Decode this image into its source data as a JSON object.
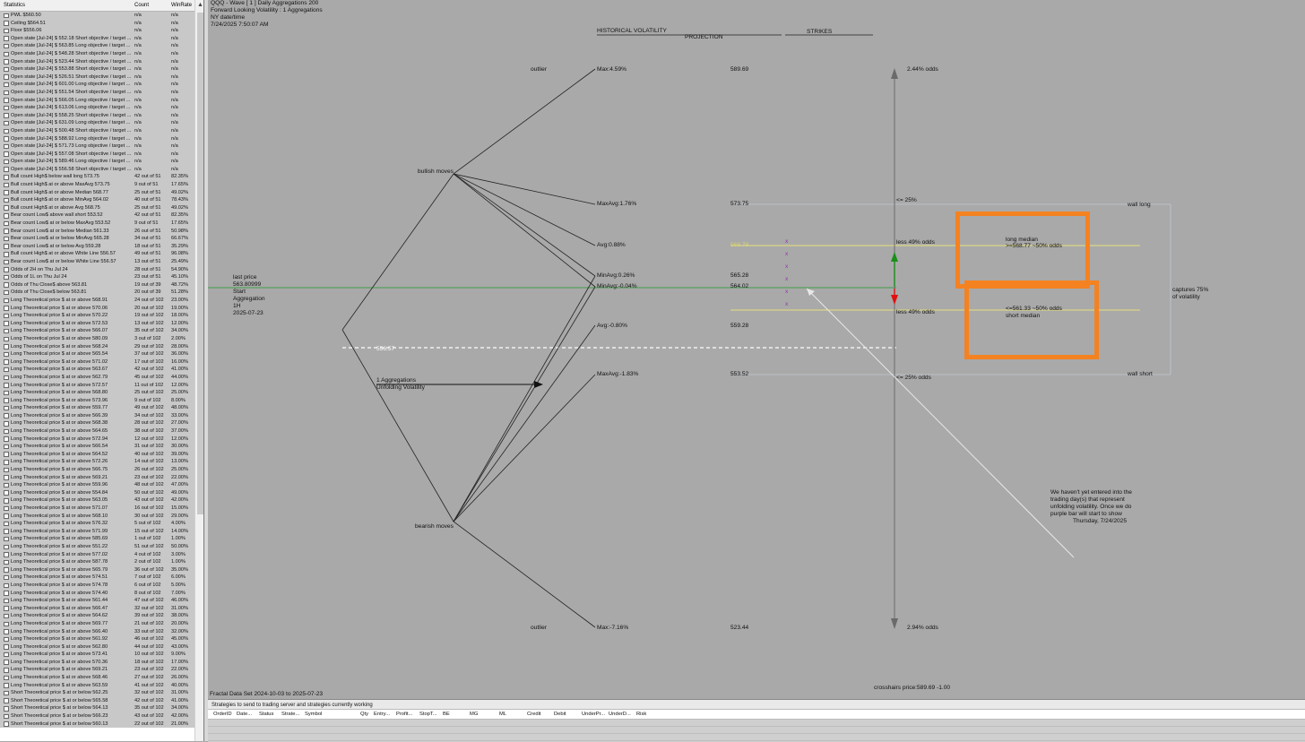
{
  "stats_panel": {
    "headers": {
      "name": "Statistics",
      "count": "Count",
      "winrate": "WinRate"
    },
    "rows": [
      [
        "PWL $560.50",
        "n/a",
        "n/a"
      ],
      [
        "Ceiling $564.51",
        "n/a",
        "n/a"
      ],
      [
        "Floor $556.06",
        "n/a",
        "n/a"
      ],
      [
        "Open state [Jul-24] $ 552.18 Short objective / target ...",
        "n/a",
        "n/a"
      ],
      [
        "Open state [Jul-24] $ 563.85 Long objective / target ...",
        "n/a",
        "n/a"
      ],
      [
        "Open state [Jul-24] $ 548.28 Short objective / target ...",
        "n/a",
        "n/a"
      ],
      [
        "Open state [Jul-24] $ 523.44 Short objective / target ...",
        "n/a",
        "n/a"
      ],
      [
        "Open state [Jul-24] $ 553.88 Short objective / target ...",
        "n/a",
        "n/a"
      ],
      [
        "Open state [Jul-24] $ 526.51 Short objective / target ...",
        "n/a",
        "n/a"
      ],
      [
        "Open state [Jul-24] $ 601.00 Long objective / target ...",
        "n/a",
        "n/a"
      ],
      [
        "Open state [Jul-24] $ 551.54 Short objective / target ...",
        "n/a",
        "n/a"
      ],
      [
        "Open state [Jul-24] $ 566.05 Long objective / target ...",
        "n/a",
        "n/a"
      ],
      [
        "Open state [Jul-24] $ 613.06 Long objective / target ...",
        "n/a",
        "n/a"
      ],
      [
        "Open state [Jul-24] $ 558.25 Short objective / target ...",
        "n/a",
        "n/a"
      ],
      [
        "Open state [Jul-24] $ 631.09 Long objective / target ...",
        "n/a",
        "n/a"
      ],
      [
        "Open state [Jul-24] $ 500.48 Short objective / target ...",
        "n/a",
        "n/a"
      ],
      [
        "Open state [Jul-24] $ 588.92 Long objective / target ...",
        "n/a",
        "n/a"
      ],
      [
        "Open state [Jul-24] $ 571.73 Long objective / target ...",
        "n/a",
        "n/a"
      ],
      [
        "Open state [Jul-24] $ 557.08 Short objective / target ...",
        "n/a",
        "n/a"
      ],
      [
        "Open state [Jul-24] $ 589.46 Long objective / target ...",
        "n/a",
        "n/a"
      ],
      [
        "Open state [Jul-24] $ 556.58 Short objective / target ...",
        "n/a",
        "n/a"
      ],
      [
        "Bull count High$ below wall long 573.75",
        "42 out of 51",
        "82.35%"
      ],
      [
        "Bull count High$ at or above MaxAvg 573.75",
        "9 out of 51",
        "17.65%"
      ],
      [
        "Bull count High$ at or above Median 568.77",
        "25 out of 51",
        "49.02%"
      ],
      [
        "Bull count High$ at or above MinAvg 564.02",
        "40 out of 51",
        "78.43%"
      ],
      [
        "Bull count High$ at or above Avg 568.75",
        "25 out of 51",
        "49.02%"
      ],
      [
        "Bear count Low$ above wall short 553.52",
        "42 out of 51",
        "82.35%"
      ],
      [
        "Bear count Low$ at or below MaxAvg 553.52",
        "9 out of 51",
        "17.65%"
      ],
      [
        "Bear count Low$ at or below Median 561.33",
        "26 out of 51",
        "50.98%"
      ],
      [
        "Bear count Low$ at or below MinAvg 565.28",
        "34 out of 51",
        "66.67%"
      ],
      [
        "Bear count Low$ at or below Avg 559.28",
        "18 out of 51",
        "35.29%"
      ],
      [
        "Bull count High$ at or above White Line 556.57",
        "49 out of 51",
        "96.08%"
      ],
      [
        "Bear count Low$ at or below White Line 556.57",
        "13 out of 51",
        "25.49%"
      ],
      [
        "Odds of 2H on Thu Jul 24",
        "28 out of 51",
        "54.90%"
      ],
      [
        "Odds of 1L on Thu Jul 24",
        "23 out of 51",
        "45.10%"
      ],
      [
        "Odds of Thu Close$ above 563.81",
        "19 out of 39",
        "48.72%"
      ],
      [
        "Odds of Thu Close$ below 563.81",
        "20 out of 39",
        "51.28%"
      ],
      [
        "Long Theoretical price $ at or above 568.91",
        "24 out of 102",
        "23.00%"
      ],
      [
        "Long Theoretical price $ at or above 570.06",
        "20 out of 102",
        "19.00%"
      ],
      [
        "Long Theoretical price $ at or above 570.22",
        "19 out of 102",
        "18.00%"
      ],
      [
        "Long Theoretical price $ at or above 572.53",
        "13 out of 102",
        "12.00%"
      ],
      [
        "Long Theoretical price $ at or above 566.07",
        "35 out of 102",
        "34.00%"
      ],
      [
        "Long Theoretical price $ at or above 580.09",
        "3 out of 102",
        "2.00%"
      ],
      [
        "Long Theoretical price $ at or above 568.24",
        "29 out of 102",
        "28.00%"
      ],
      [
        "Long Theoretical price $ at or above 565.54",
        "37 out of 102",
        "36.00%"
      ],
      [
        "Long Theoretical price $ at or above 571.02",
        "17 out of 102",
        "16.00%"
      ],
      [
        "Long Theoretical price $ at or above 563.67",
        "42 out of 102",
        "41.00%"
      ],
      [
        "Long Theoretical price $ at or above 562.79",
        "45 out of 102",
        "44.00%"
      ],
      [
        "Long Theoretical price $ at or above 572.57",
        "11 out of 102",
        "12.00%"
      ],
      [
        "Long Theoretical price $ at or above 568.80",
        "25 out of 102",
        "25.00%"
      ],
      [
        "Long Theoretical price $ at or above 573.96",
        "9 out of 102",
        "8.00%"
      ],
      [
        "Long Theoretical price $ at or above 559.77",
        "49 out of 102",
        "48.00%"
      ],
      [
        "Long Theoretical price $ at or above 566.39",
        "34 out of 102",
        "33.00%"
      ],
      [
        "Long Theoretical price $ at or above 568.38",
        "28 out of 102",
        "27.00%"
      ],
      [
        "Long Theoretical price $ at or above 564.65",
        "38 out of 102",
        "37.00%"
      ],
      [
        "Long Theoretical price $ at or above 572.94",
        "12 out of 102",
        "12.00%"
      ],
      [
        "Long Theoretical price $ at or above 566.54",
        "31 out of 102",
        "30.00%"
      ],
      [
        "Long Theoretical price $ at or above 564.52",
        "40 out of 102",
        "39.00%"
      ],
      [
        "Long Theoretical price $ at or above 572.26",
        "14 out of 102",
        "13.00%"
      ],
      [
        "Long Theoretical price $ at or above 566.75",
        "26 out of 102",
        "25.00%"
      ],
      [
        "Long Theoretical price $ at or above 569.21",
        "23 out of 102",
        "22.00%"
      ],
      [
        "Long Theoretical price $ at or above 559.96",
        "48 out of 102",
        "47.00%"
      ],
      [
        "Long Theoretical price $ at or above 554.84",
        "50 out of 102",
        "49.00%"
      ],
      [
        "Long Theoretical price $ at or above 563.05",
        "43 out of 102",
        "42.00%"
      ],
      [
        "Long Theoretical price $ at or above 571.07",
        "16 out of 102",
        "15.00%"
      ],
      [
        "Long Theoretical price $ at or above 568.10",
        "30 out of 102",
        "29.00%"
      ],
      [
        "Long Theoretical price $ at or above 576.32",
        "5 out of 102",
        "4.00%"
      ],
      [
        "Long Theoretical price $ at or above 571.99",
        "15 out of 102",
        "14.00%"
      ],
      [
        "Long Theoretical price $ at or above 585.69",
        "1 out of 102",
        "1.00%"
      ],
      [
        "Long Theoretical price $ at or above 551.22",
        "51 out of 102",
        "50.00%"
      ],
      [
        "Long Theoretical price $ at or above 577.02",
        "4 out of 102",
        "3.00%"
      ],
      [
        "Long Theoretical price $ at or above 587.78",
        "2 out of 102",
        "1.00%"
      ],
      [
        "Long Theoretical price $ at or above 565.79",
        "36 out of 102",
        "35.00%"
      ],
      [
        "Long Theoretical price $ at or above 574.51",
        "7 out of 102",
        "6.00%"
      ],
      [
        "Long Theoretical price $ at or above 574.78",
        "6 out of 102",
        "5.00%"
      ],
      [
        "Long Theoretical price $ at or above 574.40",
        "8 out of 102",
        "7.00%"
      ],
      [
        "Long Theoretical price $ at or above 561.44",
        "47 out of 102",
        "46.00%"
      ],
      [
        "Long Theoretical price $ at or above 566.47",
        "32 out of 102",
        "31.00%"
      ],
      [
        "Long Theoretical price $ at or above 564.62",
        "39 out of 102",
        "38.00%"
      ],
      [
        "Long Theoretical price $ at or above 569.77",
        "21 out of 102",
        "20.00%"
      ],
      [
        "Long Theoretical price $ at or above 566.40",
        "33 out of 102",
        "32.00%"
      ],
      [
        "Long Theoretical price $ at or above 561.92",
        "46 out of 102",
        "45.00%"
      ],
      [
        "Long Theoretical price $ at or above 562.80",
        "44 out of 102",
        "43.00%"
      ],
      [
        "Long Theoretical price $ at or above 573.41",
        "10 out of 102",
        "9.00%"
      ],
      [
        "Long Theoretical price $ at or above 570.36",
        "18 out of 102",
        "17.00%"
      ],
      [
        "Long Theoretical price $ at or above 569.21",
        "23 out of 102",
        "22.00%"
      ],
      [
        "Long Theoretical price $ at or above 568.46",
        "27 out of 102",
        "26.00%"
      ],
      [
        "Long Theoretical price $ at or above 563.59",
        "41 out of 102",
        "40.00%"
      ],
      [
        "Short Theoretical price $ at or below 562.25",
        "32 out of 102",
        "31.00%"
      ],
      [
        "Short Theoretical price $ at or below 565.58",
        "42 out of 102",
        "41.00%"
      ],
      [
        "Short Theoretical price $ at or below 564.13",
        "35 out of 102",
        "34.00%"
      ],
      [
        "Short Theoretical price $ at or below 566.23",
        "43 out of 102",
        "42.00%"
      ],
      [
        "Short Theoretical price $ at or below 560.13",
        "22 out of 102",
        "21.00%"
      ]
    ]
  },
  "chart_header": {
    "line1": "QQQ - Wave [ 1 ] Daily  Aggregations 200",
    "line2": "Forward Looking Volatility : 1 Aggregations",
    "line3": "NY date/time",
    "line4": "7/24/2025 7:50:07 AM"
  },
  "sections": {
    "historical_volatility": "HISTORICAL VOLATILITY",
    "projection": "PROJECTION",
    "strikes": "STRIKES"
  },
  "left_info": {
    "line1": "last price",
    "line2": "563.80999",
    "line3": "Start",
    "line4": "Aggregation",
    "line5": "1H",
    "line6": "2025-07-23"
  },
  "labels": {
    "bullish_moves": "bullish moves",
    "bearish_moves": "bearish moves",
    "outlier_top": "outlier",
    "outlier_bottom": "outlier",
    "white_line_value": "556.57",
    "aggregations": "1 Aggregations",
    "unfolding": "Unfolding Volatility"
  },
  "levels": [
    {
      "label": "Max:4.59%",
      "projection": "589.69"
    },
    {
      "label": "MaxAvg:1.76%",
      "projection": "573.75"
    },
    {
      "label": "Avg:0.88%",
      "projection": "568.79"
    },
    {
      "label": "MinAvg:0.26%",
      "projection": "565.28"
    },
    {
      "label": "MinAvg:-0.04%",
      "projection": "564.02"
    },
    {
      "label": "Avg:-0.80%",
      "projection": "559.28"
    },
    {
      "label": "MaxAvg:-1.83%",
      "projection": "553.52"
    },
    {
      "label": "Max:-7.16%",
      "projection": "523.44"
    }
  ],
  "right_side": {
    "odds_top": "2.44% odds",
    "odds_bottom": "2.94% odds",
    "le25_top": "<= 25%",
    "le25_bottom": "<= 25% odds",
    "less49_top": "less 49% odds",
    "less49_bottom": "less 49% odds",
    "wall_long": "wall long",
    "wall_short": "wall short",
    "long_median_1": "long median",
    "long_median_2": ">=568.77 ~50% odds",
    "short_median_1": "<=561.33 ~50% odds",
    "short_median_2": "short median",
    "captures_1": "captures 75%",
    "captures_2": "of volatility",
    "x_mark": "x"
  },
  "note": {
    "line1": "We haven't yet entered into the",
    "line2": "trading day(s) that represent",
    "line3": "unfolding volatility.  Once we do",
    "line4": "purple bar will start to show",
    "line5": "Thursday, 7/24/2025"
  },
  "footer": {
    "fractal": "Fractal Data Set 2024-10-03 to 2025-07-23",
    "crosshairs": "crosshairs price:589.69  -1.00"
  },
  "strategies": {
    "title": "Strategies to send to trading server and strategies currently working",
    "columns": [
      "OrderID",
      "Date...",
      "Status",
      "Strate...",
      "Symbol",
      "Qty",
      "Entry...",
      "Profit...",
      "StopT...",
      "BE",
      "MG",
      "ML",
      "Credit",
      "Debit",
      "UnderPr...",
      "UnderD...",
      "Risk"
    ]
  },
  "colors": {
    "background": "#a9a9a9",
    "highlight": "#f58220",
    "median_line": "#e6e07a",
    "last_price_line": "#1f9a2a",
    "arrow_up": "#1a8f1a",
    "arrow_down": "#e01010",
    "x_mark": "#9a2fb0"
  }
}
